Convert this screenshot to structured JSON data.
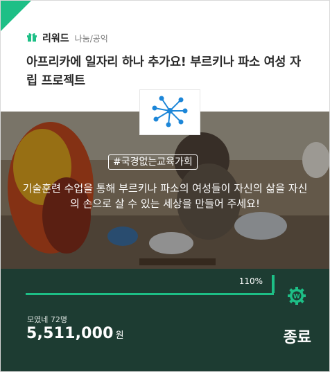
{
  "category": {
    "type": "리워드",
    "sub": "나눔/공익",
    "icon": "gift-icon"
  },
  "title": "아프리카에 일자리 하나 추가요! 부르키나 파소 여성 자립 프로젝트",
  "maker_logo": {
    "icon": "network-logo-icon"
  },
  "hashtag": "#국경없는교육가회",
  "description": "기술훈련 수업을 통해 부르키나 파소의 여성들이 자신의 삶을 자신의 손으로 살 수 있는 세상을 만들어 주세요!",
  "progress": {
    "percent_label": "110%",
    "percent": 110
  },
  "supporters": "모였네 72명",
  "amount": {
    "value": "5,511,000",
    "unit": "원"
  },
  "status": "종료",
  "colors": {
    "accent": "#1dbf86",
    "bottom_bg": "#1d3c32",
    "logo_blue": "#1c86d8"
  }
}
